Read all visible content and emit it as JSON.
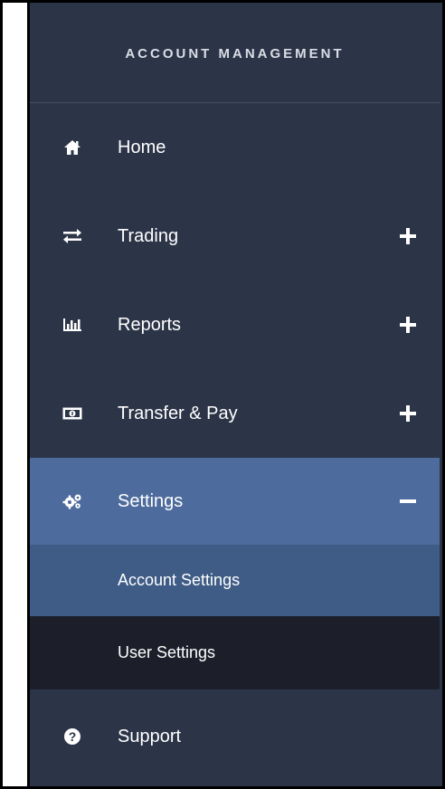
{
  "header": {
    "title": "ACCOUNT MANAGEMENT"
  },
  "nav": {
    "home": {
      "label": "Home",
      "icon": "home-icon"
    },
    "trading": {
      "label": "Trading",
      "icon": "swap-arrows-icon",
      "expand": "plus-icon"
    },
    "reports": {
      "label": "Reports",
      "icon": "bar-chart-icon",
      "expand": "plus-icon"
    },
    "transfer": {
      "label": "Transfer & Pay",
      "icon": "money-icon",
      "expand": "plus-icon"
    },
    "settings": {
      "label": "Settings",
      "icon": "gears-icon",
      "expand": "minus-icon",
      "expanded": true,
      "children": [
        {
          "label": "Account Settings",
          "selected": true
        },
        {
          "label": "User Settings",
          "selected": false
        }
      ]
    },
    "support": {
      "label": "Support",
      "icon": "question-icon"
    }
  },
  "colors": {
    "sidebar_bg": "#2c3548",
    "active_bg": "#4d6c9d",
    "selected_sub_bg": "#3f5c86",
    "dark_sub_bg": "#1c1f2a",
    "text": "#ffffff"
  }
}
